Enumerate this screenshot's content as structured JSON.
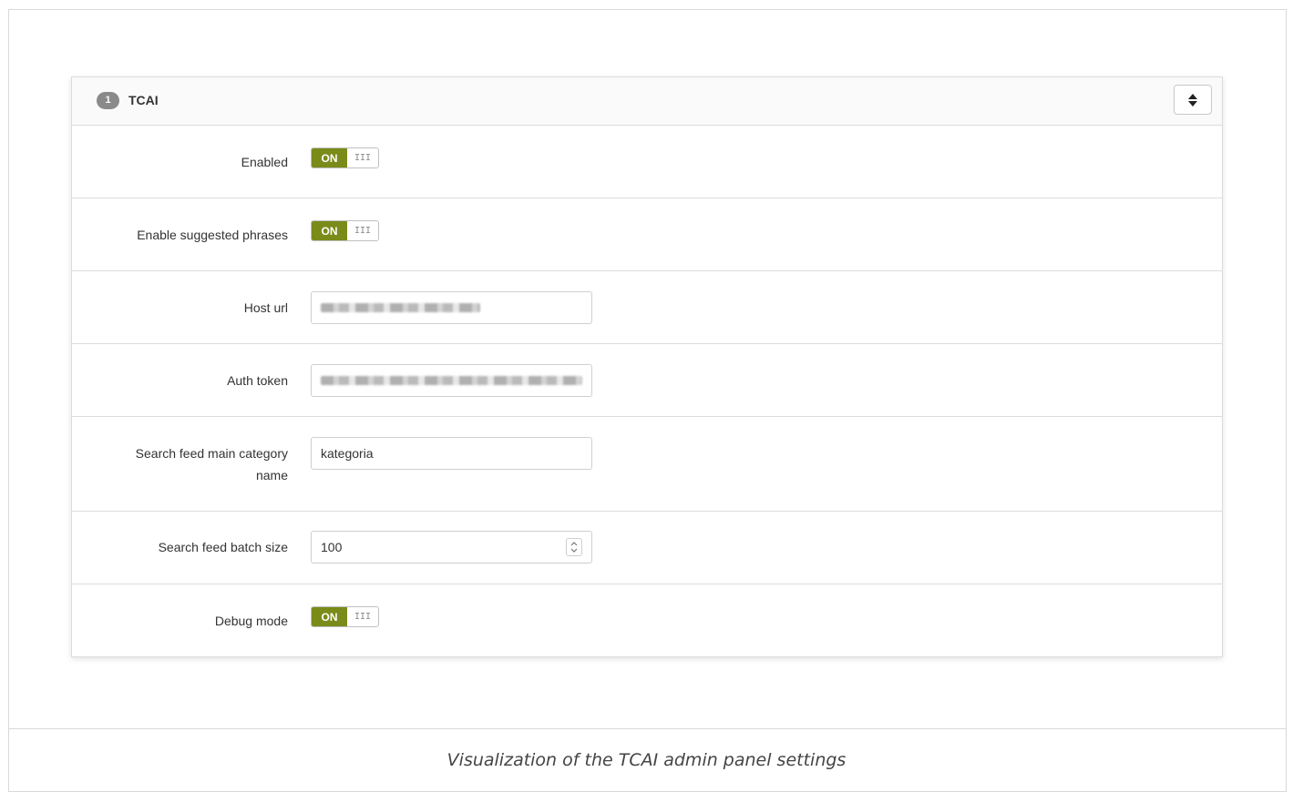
{
  "panel": {
    "badge": "1",
    "title": "TCAI",
    "sort_icon": "sort-icon"
  },
  "fields": {
    "enabled": {
      "label": "Enabled",
      "toggle_on": "ON",
      "toggle_grip": "III"
    },
    "suggested": {
      "label": "Enable suggested phrases",
      "toggle_on": "ON",
      "toggle_grip": "III"
    },
    "host_url": {
      "label": "Host url",
      "value": ""
    },
    "auth_token": {
      "label": "Auth token",
      "value": ""
    },
    "category": {
      "label_line1": "Search feed main category",
      "label_line2": "name",
      "value": "kategoria"
    },
    "batch": {
      "label": "Search feed batch size",
      "value": "100"
    },
    "debug": {
      "label": "Debug mode",
      "toggle_on": "ON",
      "toggle_grip": "III"
    }
  },
  "caption": "Visualization of the TCAI admin panel settings",
  "colors": {
    "toggle_on": "#7a8b1a",
    "border": "#dcdcdc"
  }
}
